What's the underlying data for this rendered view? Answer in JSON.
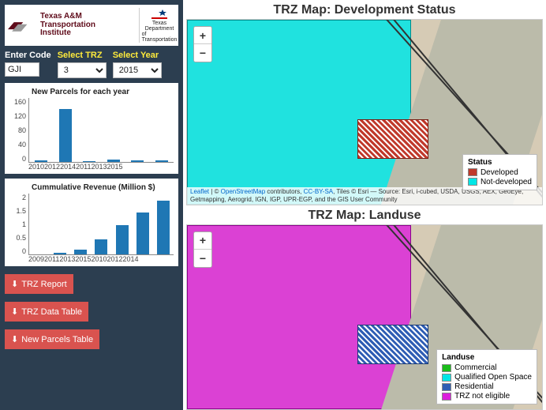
{
  "branding": {
    "tamu_line1": "Texas A&M",
    "tamu_line2": "Transportation",
    "tamu_line3": "Institute",
    "txdot_line1": "Texas",
    "txdot_line2": "Department",
    "txdot_line3": "of Transportation"
  },
  "controls": {
    "code_label": "Enter Code",
    "code_value": "GJI",
    "trz_label": "Select TRZ",
    "trz_value": "3",
    "year_label": "Select Year",
    "year_value": "2015"
  },
  "buttons": {
    "report": "TRZ Report",
    "data_table": "TRZ Data Table",
    "new_parcels": "New Parcels Table"
  },
  "chart_data": [
    {
      "type": "bar",
      "title": "New Parcels for each year",
      "categories": [
        "2010",
        "2011",
        "2012",
        "2013",
        "2014",
        "2015"
      ],
      "values": [
        3,
        130,
        2,
        5,
        4,
        3
      ],
      "ylim": [
        0,
        160
      ],
      "yticks": [
        0,
        40,
        80,
        120,
        160
      ]
    },
    {
      "type": "bar",
      "title": "Cummulative Revenue (Million $)",
      "categories": [
        "2009",
        "2010",
        "2011",
        "2012",
        "2013",
        "2014",
        "2015"
      ],
      "values": [
        0.0,
        0.05,
        0.15,
        0.5,
        0.95,
        1.35,
        1.75
      ],
      "ylim": [
        0.0,
        2.0
      ],
      "yticks": [
        0.0,
        0.5,
        1.0,
        1.5,
        2.0
      ]
    }
  ],
  "maps": {
    "status": {
      "title": "TRZ Map: Development Status",
      "legend_title": "Status",
      "legend": [
        {
          "label": "Developed",
          "color": "#c0392b"
        },
        {
          "label": "Not-developed",
          "color": "#00e6e6"
        }
      ],
      "attribution_prefix": "Leaflet",
      "attribution_mid": " | © ",
      "attribution_osm": "OpenStreetMap",
      "attribution_contrib": " contributors, ",
      "attribution_cc": "CC-BY-SA",
      "attribution_tail": ", Tiles © Esri — Source: Esri, i-cubed, USDA, USGS, AEX, GeoEye, Getmapping, Aerogrid, IGN, IGP, UPR-EGP, and the GIS User Community"
    },
    "landuse": {
      "title": "TRZ Map: Landuse",
      "legend_title": "Landuse",
      "legend": [
        {
          "label": "Commercial",
          "color": "#1abc1a"
        },
        {
          "label": "Qualified Open Space",
          "color": "#00e6e6"
        },
        {
          "label": "Residential",
          "color": "#2e5db4"
        },
        {
          "label": "TRZ not eligible",
          "color": "#dc1edc"
        }
      ]
    }
  },
  "colors": {
    "accent_red": "#d9534f",
    "sidebar_bg": "#2c3e50",
    "bar_color": "#1f77b4"
  }
}
